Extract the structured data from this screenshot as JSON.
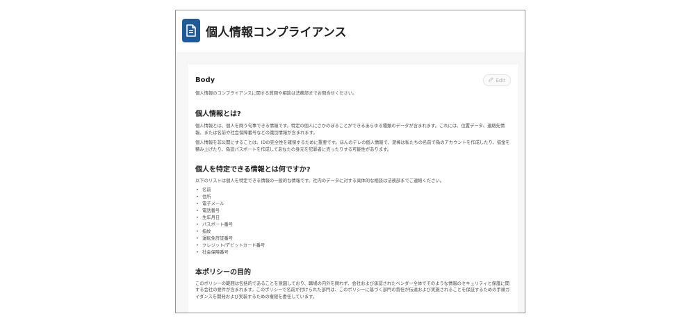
{
  "header": {
    "icon": "document-icon",
    "accent": "#1f5a96",
    "title": "個人情報コンプライアンス"
  },
  "body": {
    "label": "Body",
    "edit_label": "Edit",
    "intro": "個人情報のコンプライアンスに関する質問や相談は法務部までお問合せください。",
    "section1": {
      "heading": "個人情報とは?",
      "p1": "個人情報とは、個人を問う句事できる情報です。特定の個人にさかのぼることができるあらゆる種類のデータが含まれます。これには、位置データ、連絡先情報、または名前や社会保障番号などの識別情報が含まれます。",
      "p2": "個人情報を非公開にすることは、IDの完全性を確保するために重要です。ほんのテレの個人情報で、泥棒は私たちの名前で偽のアカウントを作成したり、借金を積み上げたり、偽造パスポートを作成してあなたの身元を犯罪者に売ったりする可能性があります。"
    },
    "section2": {
      "heading": "個人を特定できる情報とは何ですか?",
      "intro": "以下のリストは個人を特定できる情報の一般的な情報です。社内のデータに対する具体的な相談は法務部までご連絡ください。",
      "items": [
        "名前",
        "住所",
        "電子メール",
        "電話番号",
        "生年月日",
        "パスポート番号",
        "指紋",
        "運転免許証番号",
        "クレジット/デビットカード番号",
        "社会保障番号"
      ]
    },
    "section3": {
      "heading": "本ポリシーの目的",
      "p1": "このポリシーの範囲は包括的であることを意図しており、職場の内外を問わず、会社および承認されたベンダー全体でそのような情報のセキュリティと保護に関する会社の要件が含まれます。このポリシーで名前が付けられた部門は、このポリシーに基づく部門の責任が伝達および実施されることを保証するための手順ガイダンスを開発および実装するための権限を委任しています。"
    }
  }
}
